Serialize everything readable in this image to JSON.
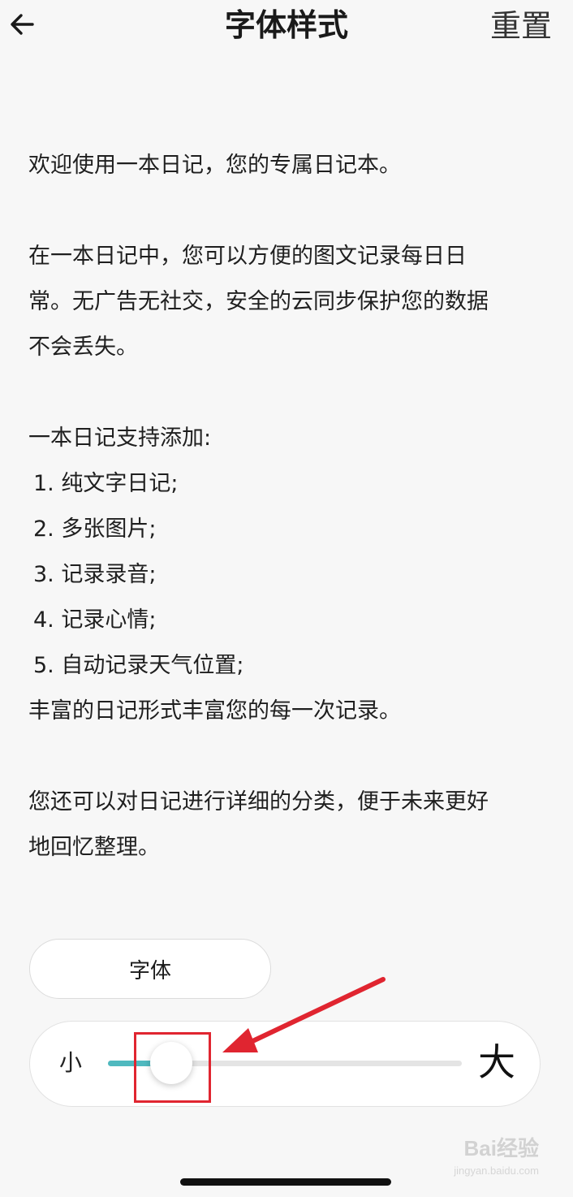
{
  "header": {
    "title": "字体样式",
    "reset_label": "重置"
  },
  "content": {
    "para1": "欢迎使用一本日记，您的专属日记本。",
    "para2_line1": "在一本日记中，您可以方便的图文记录每日日",
    "para2_line2": "常。无广告无社交，安全的云同步保护您的数据",
    "para2_line3": "不会丢失。",
    "list_intro": "一本日记支持添加:",
    "list_items": [
      "1. 纯文字日记;",
      "2. 多张图片;",
      "3. 记录录音;",
      "4. 记录心情;",
      "5. 自动记录天气位置;"
    ],
    "list_outro": "丰富的日记形式丰富您的每一次记录。",
    "para4_line1": "您还可以对日记进行详细的分类，便于未来更好",
    "para4_line2": "地回忆整理。"
  },
  "controls": {
    "font_button_label": "字体",
    "size_small_label": "小",
    "size_large_label": "大",
    "size_slider_value": 0.18
  },
  "colors": {
    "accent": "#4fb9bf",
    "annotation": "#e02530"
  },
  "watermark": {
    "text": "Bai经验",
    "sub": "jingyan.baidu.com"
  }
}
